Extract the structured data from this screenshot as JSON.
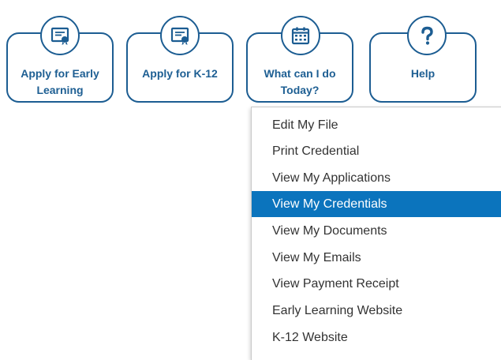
{
  "nav": {
    "tiles": [
      {
        "label": "Apply for Early Learning",
        "icon": "certificate-icon"
      },
      {
        "label": "Apply for K-12",
        "icon": "certificate-icon"
      },
      {
        "label": "What can I do Today?",
        "icon": "calendar-icon"
      },
      {
        "label": "Help",
        "icon": "question-icon"
      }
    ]
  },
  "menu": {
    "items": [
      {
        "label": "Edit My File"
      },
      {
        "label": "Print Credential"
      },
      {
        "label": "View My Applications"
      },
      {
        "label": "View My Credentials",
        "state": "highlighted"
      },
      {
        "label": "View My Documents"
      },
      {
        "label": "View My Emails"
      },
      {
        "label": "View Payment Receipt"
      },
      {
        "label": "Early Learning Website"
      },
      {
        "label": "K-12 Website"
      }
    ]
  },
  "colors": {
    "brand": "#1c5d92",
    "highlight": "#0b74bd",
    "menu_text": "#333333"
  }
}
